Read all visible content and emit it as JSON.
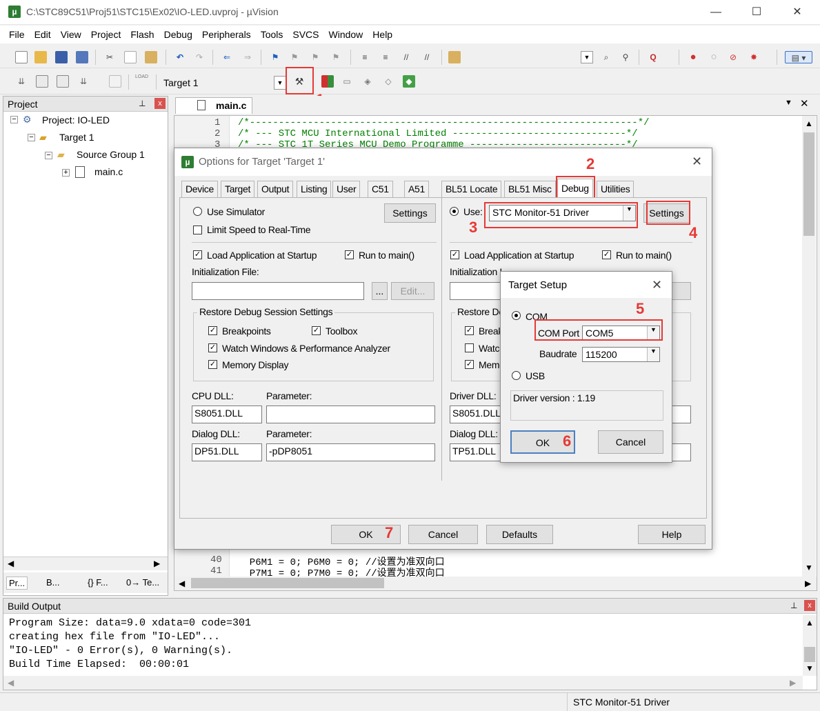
{
  "window": {
    "title": "C:\\STC89C51\\Proj51\\STC15\\Ex02\\IO-LED.uvproj - µVision",
    "minimize": "—",
    "maximize": "☐",
    "close": "✕"
  },
  "menu": [
    "File",
    "Edit",
    "View",
    "Project",
    "Flash",
    "Debug",
    "Peripherals",
    "Tools",
    "SVCS",
    "Window",
    "Help"
  ],
  "toolbar2": {
    "load_label": "LOAD",
    "target_select": "Target 1"
  },
  "project_panel": {
    "title": "Project",
    "pin": "ꟸ",
    "close": "x",
    "tree": {
      "project": "Project: IO-LED",
      "target": "Target 1",
      "group": "Source Group 1",
      "file": "main.c"
    },
    "bottom_tabs": [
      "Pr...",
      "B...",
      "{} F...",
      "0→ Te..."
    ]
  },
  "editor": {
    "tab": "main.c",
    "lines": [
      {
        "n": "1",
        "t": "/*-------------------------------------------------------------------*/"
      },
      {
        "n": "2",
        "t": "/* --- STC MCU International Limited ------------------------------*/"
      },
      {
        "n": "3",
        "t": "/* --- STC 1T Series MCU Demo Programme ---------------------------*/"
      },
      {
        "n": "40",
        "t": "  P6M1 = 0; P6M0 = 0; //设置为准双向口"
      },
      {
        "n": "41",
        "t": "  P7M1 = 0; P7M0 = 0; //设置为准双向口"
      }
    ]
  },
  "options_dialog": {
    "title": "Options for Target 'Target 1'",
    "tabs": [
      "Device",
      "Target",
      "Output",
      "Listing",
      "User",
      "C51",
      "A51",
      "BL51 Locate",
      "BL51 Misc",
      "Debug",
      "Utilities"
    ],
    "left": {
      "use_simulator": "Use Simulator",
      "settings": "Settings",
      "limit_speed": "Limit Speed to Real-Time",
      "load_app": "Load Application at Startup",
      "run_main": "Run to main()",
      "init_file": "Initialization File:",
      "browse": "...",
      "edit": "Edit...",
      "restore_title": "Restore Debug Session Settings",
      "breakpoints": "Breakpoints",
      "toolbox": "Toolbox",
      "watch": "Watch Windows & Performance Analyzer",
      "memory": "Memory Display",
      "cpu_dll": "CPU DLL:",
      "cpu_dll_val": "S8051.DLL",
      "param": "Parameter:",
      "param_val": "",
      "dialog_dll": "Dialog DLL:",
      "dialog_dll_val": "DP51.DLL",
      "dialog_param_val": "-pDP8051"
    },
    "right": {
      "use": "Use:",
      "driver": "STC Monitor-51 Driver",
      "settings": "Settings",
      "load_app": "Load Application at Startup",
      "run_main": "Run to main()",
      "init_file": "Initialization File:",
      "restore_title": "Restore Debug Session Settings",
      "breakpoints": "Breakpoints",
      "watch": "Watch Windows",
      "memory": "Memory Display",
      "driver_dll": "Driver DLL:",
      "driver_dll_val": "S8051.DLL",
      "dialog_dll": "Dialog DLL:",
      "dialog_dll_val": "TP51.DLL"
    },
    "ok": "OK",
    "cancel": "Cancel",
    "defaults": "Defaults",
    "help": "Help"
  },
  "target_setup": {
    "title": "Target Setup",
    "com": "COM",
    "com_port_label": "COM Port",
    "com_port": "COM5",
    "baudrate_label": "Baudrate",
    "baudrate": "115200",
    "usb": "USB",
    "driver_version": "Driver version : 1.19",
    "ok": "OK",
    "cancel": "Cancel"
  },
  "annotations": [
    "1",
    "2",
    "3",
    "4",
    "5",
    "6",
    "7"
  ],
  "build_output": {
    "title": "Build Output",
    "lines": [
      "Program Size: data=9.0 xdata=0 code=301",
      "creating hex file from \"IO-LED\"...",
      "\"IO-LED\" - 0 Error(s), 0 Warning(s).",
      "Build Time Elapsed:  00:00:01"
    ]
  },
  "status_bar": {
    "driver": "STC Monitor-51 Driver"
  },
  "colors": {
    "annotation": "#e53935",
    "code_comment": "#008000",
    "code_number": "#0000ff"
  }
}
